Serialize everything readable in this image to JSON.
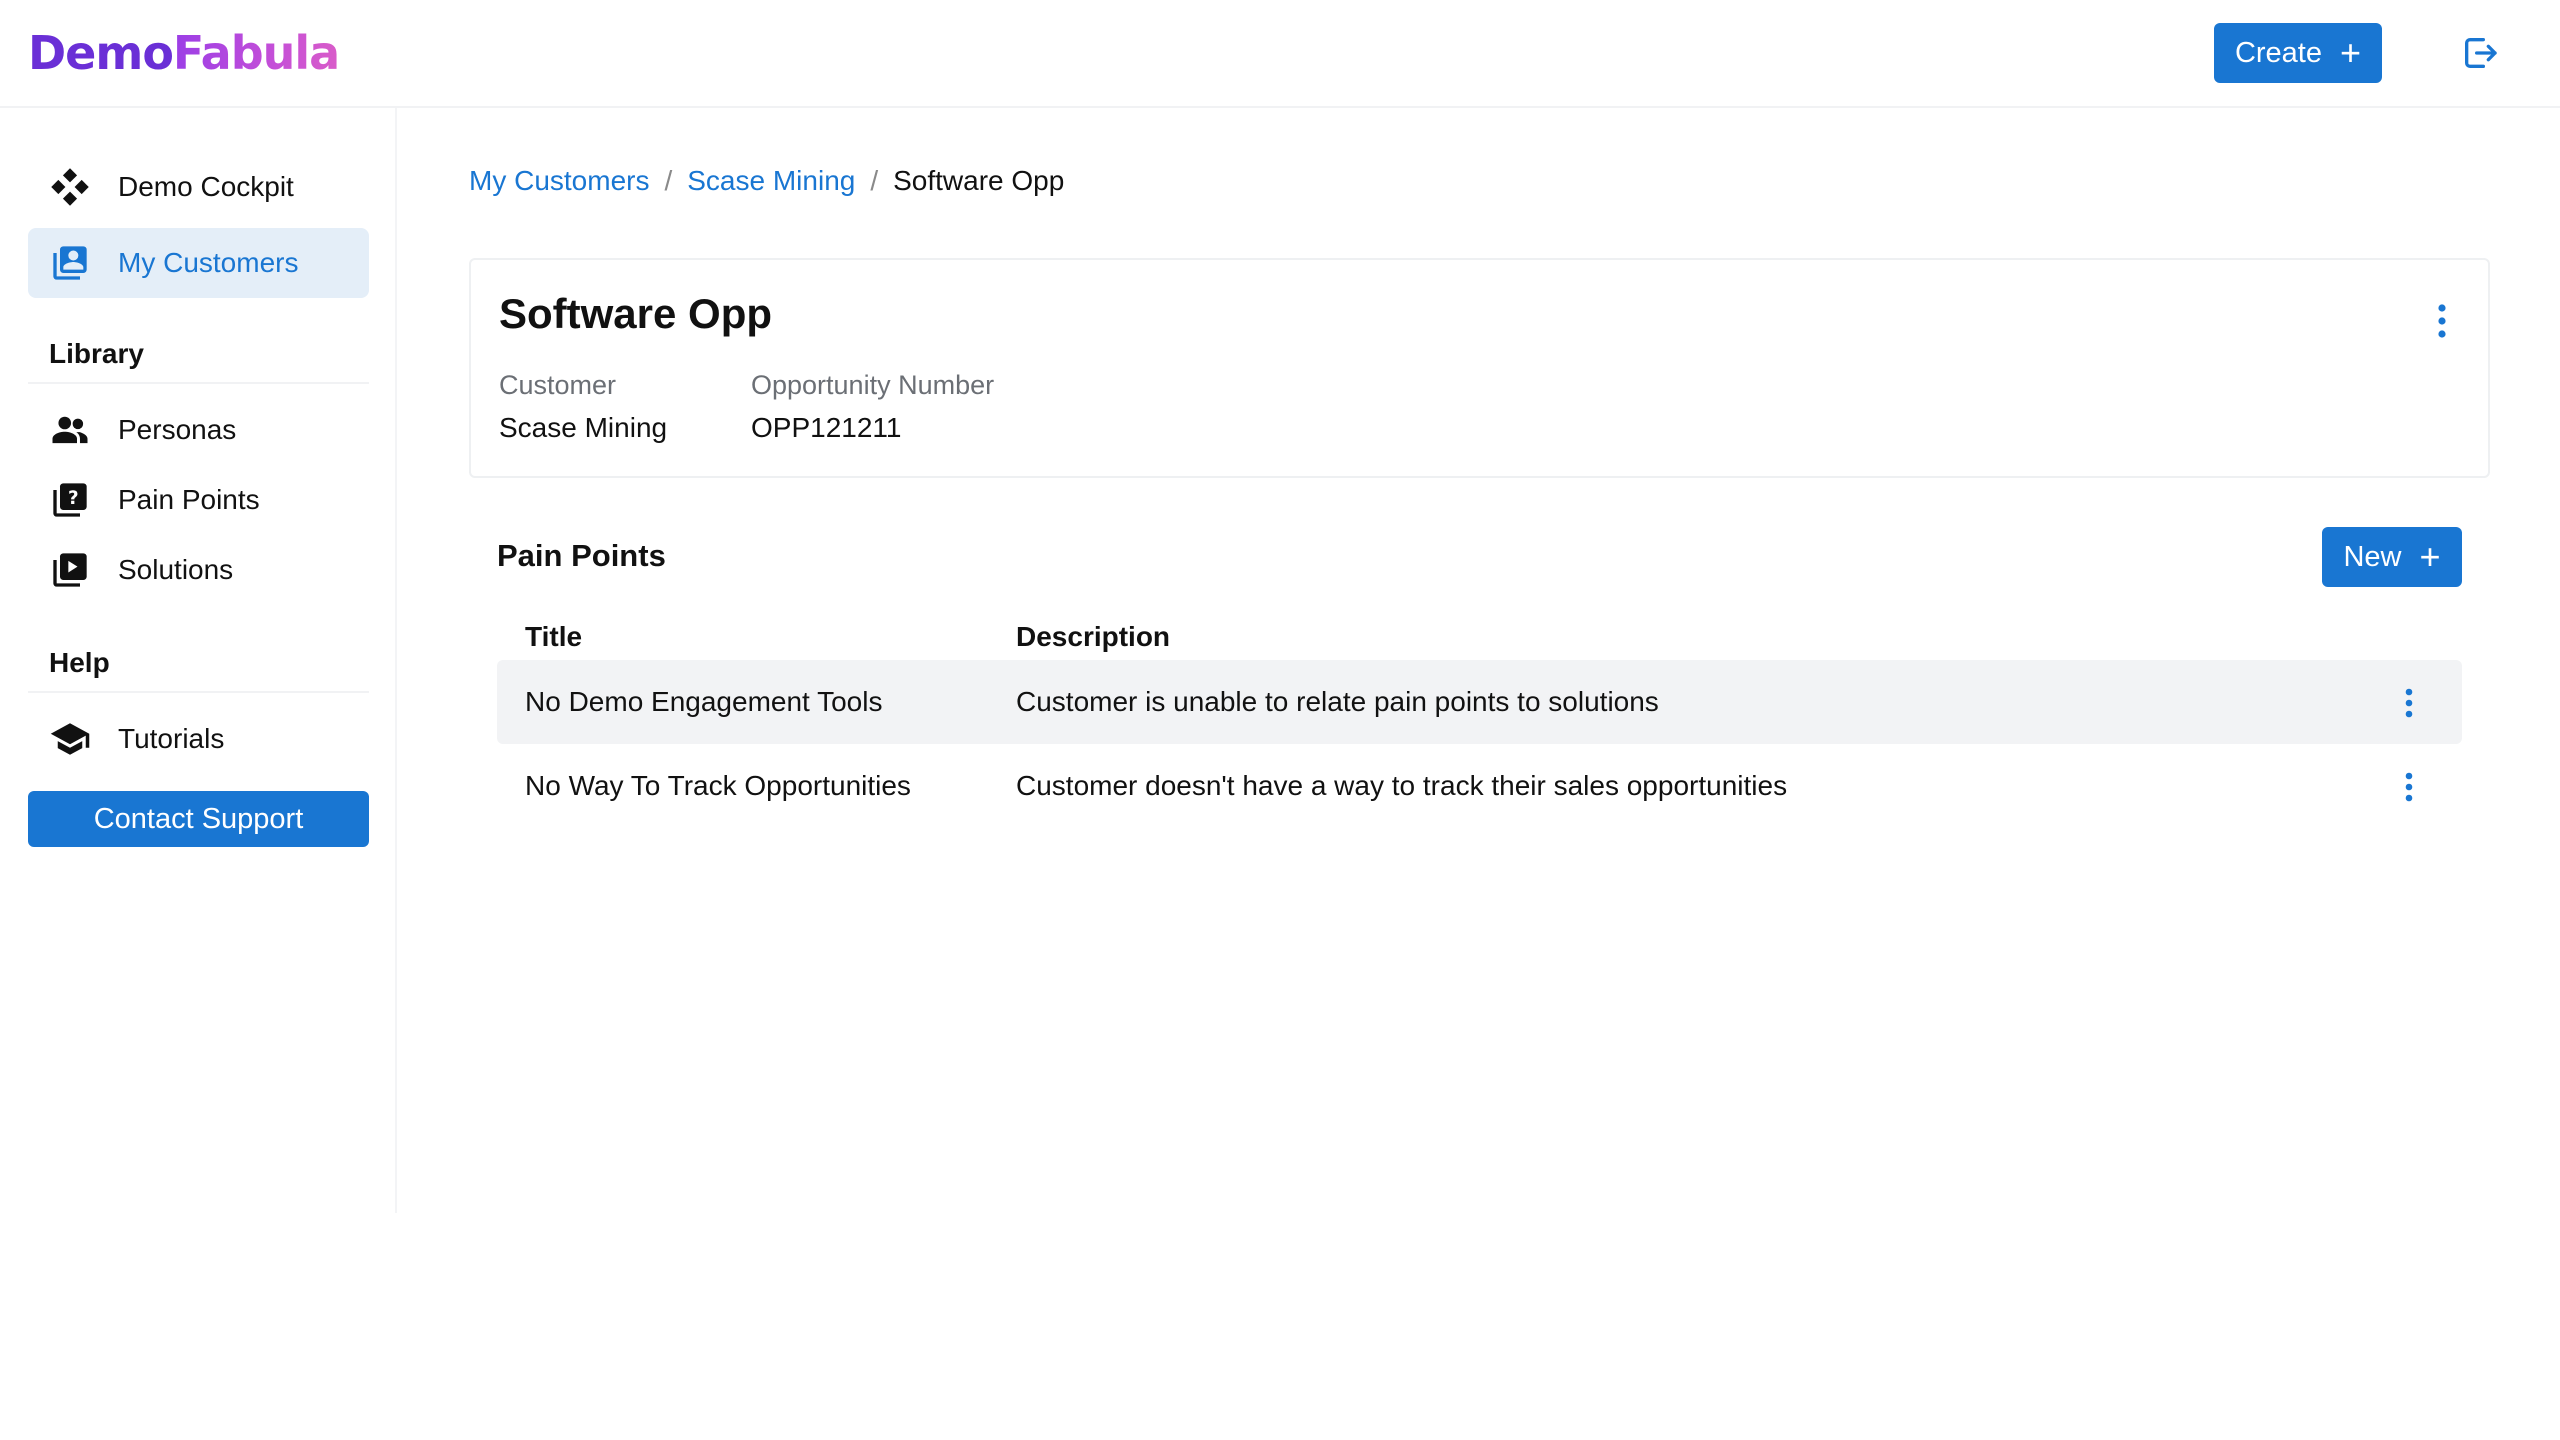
{
  "app": {
    "logo_part1": "Demo",
    "logo_part2": "Fabula"
  },
  "header": {
    "create_label": "Create",
    "create_icon": "plus-icon",
    "logout_icon": "logout-icon"
  },
  "sidebar": {
    "top_items": [
      {
        "label": "Demo Cockpit",
        "icon": "gamepad-icon"
      },
      {
        "label": "My Customers",
        "icon": "contacts-icon",
        "active": true
      }
    ],
    "library_heading": "Library",
    "library_items": [
      {
        "label": "Personas",
        "icon": "people-icon"
      },
      {
        "label": "Pain Points",
        "icon": "question-library-icon"
      },
      {
        "label": "Solutions",
        "icon": "video-library-icon"
      }
    ],
    "help_heading": "Help",
    "help_items": [
      {
        "label": "Tutorials",
        "icon": "graduation-cap-icon"
      }
    ],
    "support_label": "Contact Support"
  },
  "breadcrumb": {
    "items": [
      "My Customers",
      "Scase Mining"
    ],
    "separator": "/",
    "current": "Software Opp"
  },
  "opportunity": {
    "title": "Software Opp",
    "customer_label": "Customer",
    "customer_value": "Scase Mining",
    "number_label": "Opportunity Number",
    "number_value": "OPP121211"
  },
  "pain_points": {
    "heading": "Pain Points",
    "new_label": "New",
    "columns": [
      "Title",
      "Description"
    ],
    "rows": [
      {
        "title": "No Demo Engagement Tools",
        "description": "Customer is unable to relate pain points to solutions"
      },
      {
        "title": "No Way To Track Opportunities",
        "description": "Customer doesn't have a way to track their sales opportunities"
      }
    ]
  },
  "colors": {
    "primary": "#1976d2",
    "active_bg": "#e4eef8",
    "logo_purple": "#6a2fd6",
    "logo_pink": "#d95cc9"
  }
}
